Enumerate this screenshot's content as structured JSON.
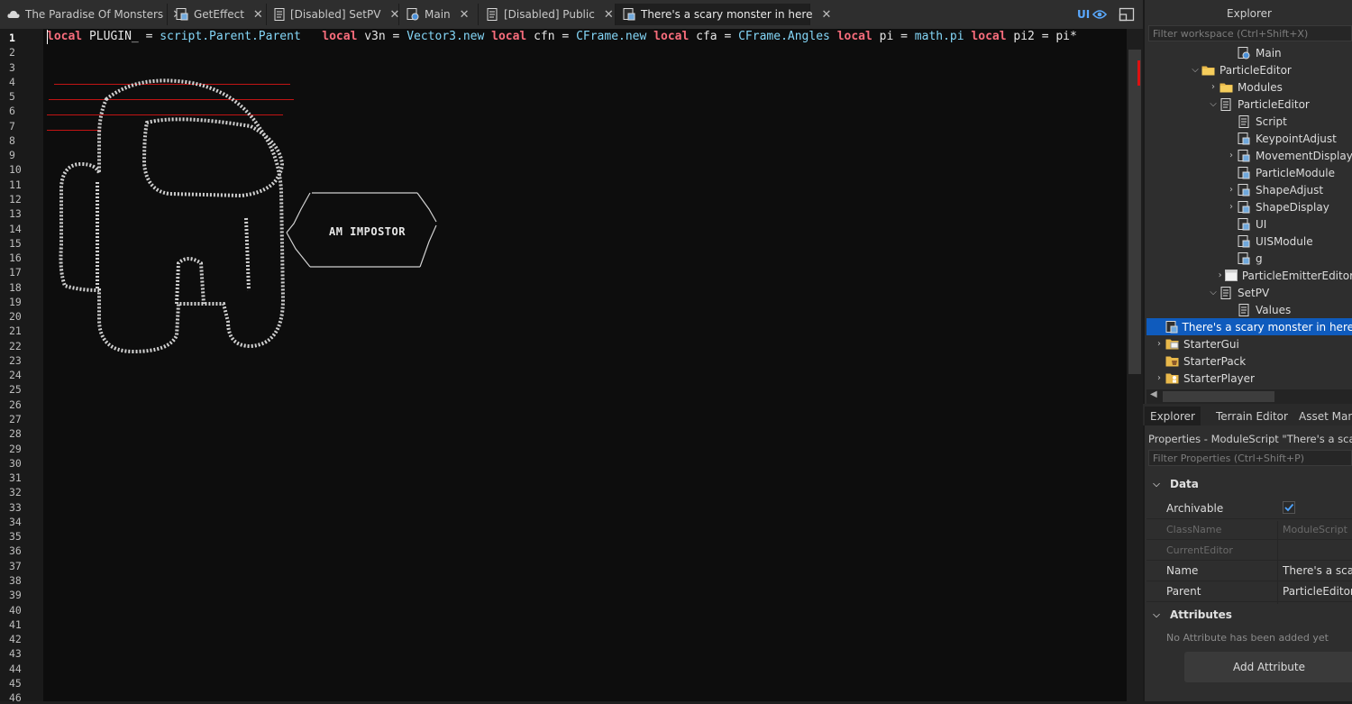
{
  "tabs": [
    {
      "label": "The Paradise Of Monsters",
      "icon": "cloud-icon"
    },
    {
      "label": "GetEffect",
      "icon": "module-script-icon"
    },
    {
      "label": "[Disabled] SetPV",
      "icon": "script-icon"
    },
    {
      "label": "Main",
      "icon": "local-script-icon"
    },
    {
      "label": "[Disabled] Public",
      "icon": "script-icon"
    },
    {
      "label": "There's a scary monster in here",
      "icon": "module-script-icon"
    }
  ],
  "ui_toggle_label": "UI",
  "editor": {
    "line_count": 46,
    "code_line1": [
      {
        "t": "local",
        "c": "kw"
      },
      {
        "t": " PLUGIN_ = ",
        "c": ""
      },
      {
        "t": "script.Parent.Parent",
        "c": "fn"
      },
      {
        "t": "   ",
        "c": ""
      },
      {
        "t": "local",
        "c": "kw"
      },
      {
        "t": " v3n = ",
        "c": ""
      },
      {
        "t": "Vector3.new",
        "c": "fn"
      },
      {
        "t": " ",
        "c": ""
      },
      {
        "t": "local",
        "c": "kw"
      },
      {
        "t": " cfn = ",
        "c": ""
      },
      {
        "t": "CFrame.new",
        "c": "fn"
      },
      {
        "t": " ",
        "c": ""
      },
      {
        "t": "local",
        "c": "kw"
      },
      {
        "t": " cfa = ",
        "c": ""
      },
      {
        "t": "CFrame.Angles",
        "c": "fn"
      },
      {
        "t": " ",
        "c": ""
      },
      {
        "t": "local",
        "c": "kw"
      },
      {
        "t": " pi = ",
        "c": ""
      },
      {
        "t": "math.pi",
        "c": "fn"
      },
      {
        "t": " ",
        "c": ""
      },
      {
        "t": "local",
        "c": "kw"
      },
      {
        "t": " pi2 = pi*",
        "c": ""
      }
    ],
    "speech_text": "AM IMPOSTOR"
  },
  "explorer": {
    "title": "Explorer",
    "filter_placeholder": "Filter workspace (Ctrl+Shift+X)",
    "items": [
      {
        "label": "Main",
        "indent": 4,
        "chev": "",
        "icon": "local-script-icon"
      },
      {
        "label": "ParticleEditor",
        "indent": 2,
        "chev": "down",
        "icon": "folder-icon"
      },
      {
        "label": "Modules",
        "indent": 3,
        "chev": "right",
        "icon": "folder-icon"
      },
      {
        "label": "ParticleEditor",
        "indent": 3,
        "chev": "down",
        "icon": "script-icon"
      },
      {
        "label": "Script",
        "indent": 4,
        "chev": "",
        "icon": "script-icon"
      },
      {
        "label": "KeypointAdjust",
        "indent": 4,
        "chev": "",
        "icon": "module-script-icon"
      },
      {
        "label": "MovementDisplay",
        "indent": 4,
        "chev": "right",
        "icon": "module-script-icon"
      },
      {
        "label": "ParticleModule",
        "indent": 4,
        "chev": "",
        "icon": "module-script-icon"
      },
      {
        "label": "ShapeAdjust",
        "indent": 4,
        "chev": "right",
        "icon": "module-script-icon"
      },
      {
        "label": "ShapeDisplay",
        "indent": 4,
        "chev": "right",
        "icon": "module-script-icon"
      },
      {
        "label": "UI",
        "indent": 4,
        "chev": "",
        "icon": "module-script-icon"
      },
      {
        "label": "UISModule",
        "indent": 4,
        "chev": "",
        "icon": "module-script-icon"
      },
      {
        "label": "g",
        "indent": 4,
        "chev": "",
        "icon": "module-script-icon"
      },
      {
        "label": "ParticleEmitterEditor",
        "indent": 4,
        "chev": "right",
        "icon": "window-icon"
      },
      {
        "label": "SetPV",
        "indent": 3,
        "chev": "down",
        "icon": "script-icon"
      },
      {
        "label": "Values",
        "indent": 4,
        "chev": "",
        "icon": "script-icon"
      },
      {
        "label": "There's a scary monster in here",
        "indent": 3,
        "chev": "",
        "icon": "module-script-icon",
        "selected": true
      },
      {
        "label": "StarterGui",
        "indent": 0,
        "chev": "right",
        "icon": "starter-gui-icon"
      },
      {
        "label": "StarterPack",
        "indent": 0,
        "chev": "",
        "icon": "starter-pack-icon"
      },
      {
        "label": "StarterPlayer",
        "indent": 0,
        "chev": "right",
        "icon": "starter-player-icon"
      }
    ]
  },
  "panel_tabs": [
    "Explorer",
    "Terrain Editor",
    "Asset Manager"
  ],
  "properties": {
    "title": "Properties - ModuleScript \"There's a scary monster in here\"",
    "filter_placeholder": "Filter Properties (Ctrl+Shift+P)",
    "section_data": "Data",
    "archivable_label": "Archivable",
    "archivable_checked": true,
    "rows": [
      {
        "name": "ClassName",
        "value": "ModuleScript",
        "disabled": true
      },
      {
        "name": "CurrentEditor",
        "value": "",
        "disabled": true
      },
      {
        "name": "Name",
        "value": "There's a scary monster in here",
        "disabled": false
      },
      {
        "name": "Parent",
        "value": "ParticleEditor",
        "disabled": false
      }
    ],
    "section_attributes": "Attributes",
    "no_attr_text": "No Attribute has been added yet",
    "add_attr_label": "Add Attribute"
  },
  "colors": {
    "keyword": "#f86d7c",
    "builtin": "#84d6f7",
    "selection": "#0f5bbd",
    "ui_accent": "#5aa9ff"
  }
}
